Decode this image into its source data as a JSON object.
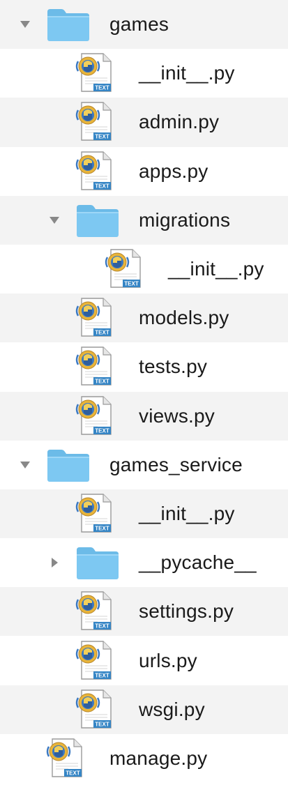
{
  "tree": {
    "rows": [
      {
        "name": "games",
        "kind": "folder",
        "depth": 0,
        "expanded": true,
        "icon": "folder-icon"
      },
      {
        "name": "__init__.py",
        "kind": "file",
        "depth": 1,
        "icon": "python-file-icon"
      },
      {
        "name": "admin.py",
        "kind": "file",
        "depth": 1,
        "icon": "python-file-icon"
      },
      {
        "name": "apps.py",
        "kind": "file",
        "depth": 1,
        "icon": "python-file-icon"
      },
      {
        "name": "migrations",
        "kind": "folder",
        "depth": 1,
        "expanded": true,
        "icon": "folder-icon"
      },
      {
        "name": "__init__.py",
        "kind": "file",
        "depth": 2,
        "icon": "python-file-icon"
      },
      {
        "name": "models.py",
        "kind": "file",
        "depth": 1,
        "icon": "python-file-icon"
      },
      {
        "name": "tests.py",
        "kind": "file",
        "depth": 1,
        "icon": "python-file-icon"
      },
      {
        "name": "views.py",
        "kind": "file",
        "depth": 1,
        "icon": "python-file-icon"
      },
      {
        "name": "games_service",
        "kind": "folder",
        "depth": 0,
        "expanded": true,
        "icon": "folder-icon"
      },
      {
        "name": "__init__.py",
        "kind": "file",
        "depth": 1,
        "icon": "python-file-icon"
      },
      {
        "name": "__pycache__",
        "kind": "folder",
        "depth": 1,
        "expanded": false,
        "icon": "folder-icon"
      },
      {
        "name": "settings.py",
        "kind": "file",
        "depth": 1,
        "icon": "python-file-icon"
      },
      {
        "name": "urls.py",
        "kind": "file",
        "depth": 1,
        "icon": "python-file-icon"
      },
      {
        "name": "wsgi.py",
        "kind": "file",
        "depth": 1,
        "icon": "python-file-icon"
      },
      {
        "name": "manage.py",
        "kind": "file",
        "depth": 0,
        "icon": "python-file-icon"
      }
    ],
    "file_badge_text": "TEXT",
    "colors": {
      "row_alt": "#f3f3f3",
      "folder": "#7dc8f2",
      "folder_tab": "#6cbbe8",
      "disclosure": "#888888"
    }
  }
}
